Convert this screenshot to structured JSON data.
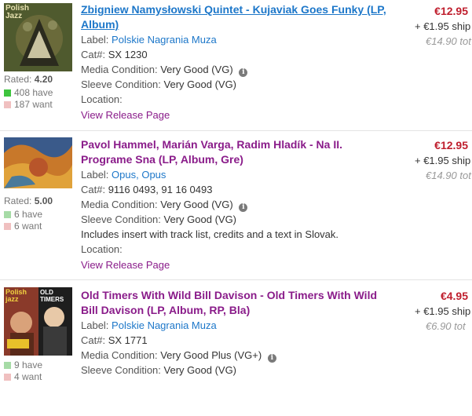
{
  "listings": [
    {
      "cover_text": "Polish Jazz",
      "rating_label": "Rated:",
      "rating_value": "4.20",
      "have": "408 have",
      "want": "187 want",
      "title": "Zbigniew Namysłowski Quintet - Kujaviak Goes Funky (LP, Album)",
      "label_key": "Label:",
      "label_value": "Polskie Nagrania Muza",
      "cat_key": "Cat#:",
      "cat_value": "SX 1230",
      "media_key": "Media Condition:",
      "media_value": "Very Good (VG)",
      "sleeve_key": "Sleeve Condition:",
      "sleeve_value": "Very Good (VG)",
      "location_key": "Location:",
      "release_link": "View Release Page",
      "price": "€12.95",
      "shipping": "+ €1.95 ship",
      "total": "€14.90 tot"
    },
    {
      "rating_label": "Rated:",
      "rating_value": "5.00",
      "have": "6 have",
      "want": "6 want",
      "title": "Pavol Hammel, Marián Varga, Radim Hladík - Na II. Programe Sna (LP, Album, Gre)",
      "label_key": "Label:",
      "label_value": "Opus, Opus",
      "cat_key": "Cat#:",
      "cat_value": "9116 0493, 91 16 0493",
      "media_key": "Media Condition:",
      "media_value": "Very Good (VG)",
      "sleeve_key": "Sleeve Condition:",
      "sleeve_value": "Very Good (VG)",
      "comment": "Includes insert with track list, credits and a text in Slovak.",
      "location_key": "Location:",
      "release_link": "View Release Page",
      "price": "€12.95",
      "shipping": "+ €1.95 ship",
      "total": "€14.90 tot"
    },
    {
      "cover_text_left": "Polish jazz",
      "cover_text_right": "OLD TIMERS",
      "have": "9 have",
      "want": "4 want",
      "title": "Old Timers With Wild Bill Davison - Old Timers With Wild Bill Davison (LP, Album, RP, Bla)",
      "label_key": "Label:",
      "label_value": "Polskie Nagrania Muza",
      "cat_key": "Cat#:",
      "cat_value": "SX 1771",
      "media_key": "Media Condition:",
      "media_value": "Very Good Plus (VG+)",
      "sleeve_key": "Sleeve Condition:",
      "sleeve_value": "Very Good (VG)",
      "price": "€4.95",
      "shipping": "+ €1.95 ship",
      "total": "€6.90 tot"
    }
  ],
  "colors": {
    "price": "#bf1e2d",
    "title_visited": "#8a1c8a",
    "title_link": "#1d77c9",
    "have": "#3ec43e",
    "want": "#f0c0c0"
  },
  "icons": {
    "info": "info-icon"
  }
}
